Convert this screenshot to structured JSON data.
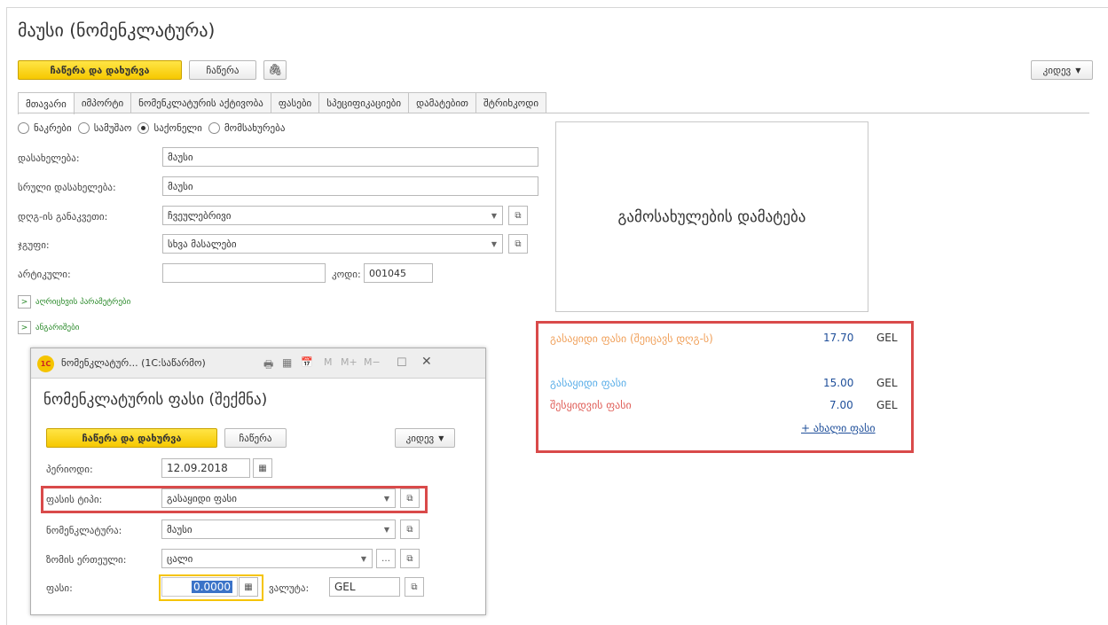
{
  "form": {
    "title": "მაუსი (ნომენკლატურა)",
    "save_close": "ჩაწერა და დახურვა",
    "save": "ჩაწერა",
    "attach_icon": "paperclip-icon",
    "more": "კიდევ"
  },
  "tabs": [
    "მთავარი",
    "იმპორტი",
    "ნომენკლატურის აქტივობა",
    "ფასები",
    "სპეციფიკაციები",
    "დამატებით",
    "შტრიხკოდი"
  ],
  "kind": {
    "options": [
      "ნაკრები",
      "სამუშაო",
      "საქონელი",
      "მომსახურება"
    ],
    "selected": "საქონელი"
  },
  "fields": {
    "name_label": "დასახელება:",
    "name_value": "მაუსი",
    "full_name_label": "სრული დასახელება:",
    "full_name_value": "მაუსი",
    "vat_label": "დღგ-ის განაკვეთი:",
    "vat_value": "ჩვეულებრივი",
    "group_label": "ჯგუფი:",
    "group_value": "სხვა მასალები",
    "article_label": "არტიკული:",
    "article_value": "",
    "code_label": "კოდი:",
    "code_value": "001045"
  },
  "expanders": [
    "აღრიცხვის პარამეტრები",
    "ანგარიშები"
  ],
  "image_placeholder": "გამოსახულების დამატება",
  "prices": {
    "rows": [
      {
        "name": "გასაყიდი ფასი (შეიცავს დღგ-ს)",
        "value": "17.70",
        "currency": "GEL",
        "color": "#f0a05a"
      },
      {
        "name": "გასაყიდი ფასი",
        "value": "15.00",
        "currency": "GEL",
        "color": "#5aaee8"
      },
      {
        "name": "შესყიდვის ფასი",
        "value": "7.00",
        "currency": "GEL",
        "color": "#e0605a"
      }
    ],
    "add_link": "+ ახალი ფასი",
    "value_color": "#1f4f9a"
  },
  "dialog": {
    "window_title": "ნომენკლატურ...  (1C:საწარმო)",
    "heading": "ნომენკლატურის ფასი (შექმნა)",
    "save_close": "ჩაწერა და დახურვა",
    "save": "ჩაწერა",
    "more": "კიდევ",
    "period_label": "პერიოდი:",
    "period_value": "12.09.2018",
    "price_type_label": "ფასის ტიპი:",
    "price_type_value": "გასაყიდი ფასი",
    "nomenclature_label": "ნომენკლატურა:",
    "nomenclature_value": "მაუსი",
    "unit_label": "ზომის ერთეული:",
    "unit_value": "ცალი",
    "price_label": "ფასი:",
    "price_value": "0.0000",
    "currency_label": "ვალუტა:",
    "currency_value": "GEL",
    "tools": [
      "M",
      "M+",
      "M−"
    ]
  },
  "colors": {
    "accent_yellow": "#f6c800",
    "highlight_red": "#d94a4a",
    "focus_yellow": "#f5c400"
  }
}
